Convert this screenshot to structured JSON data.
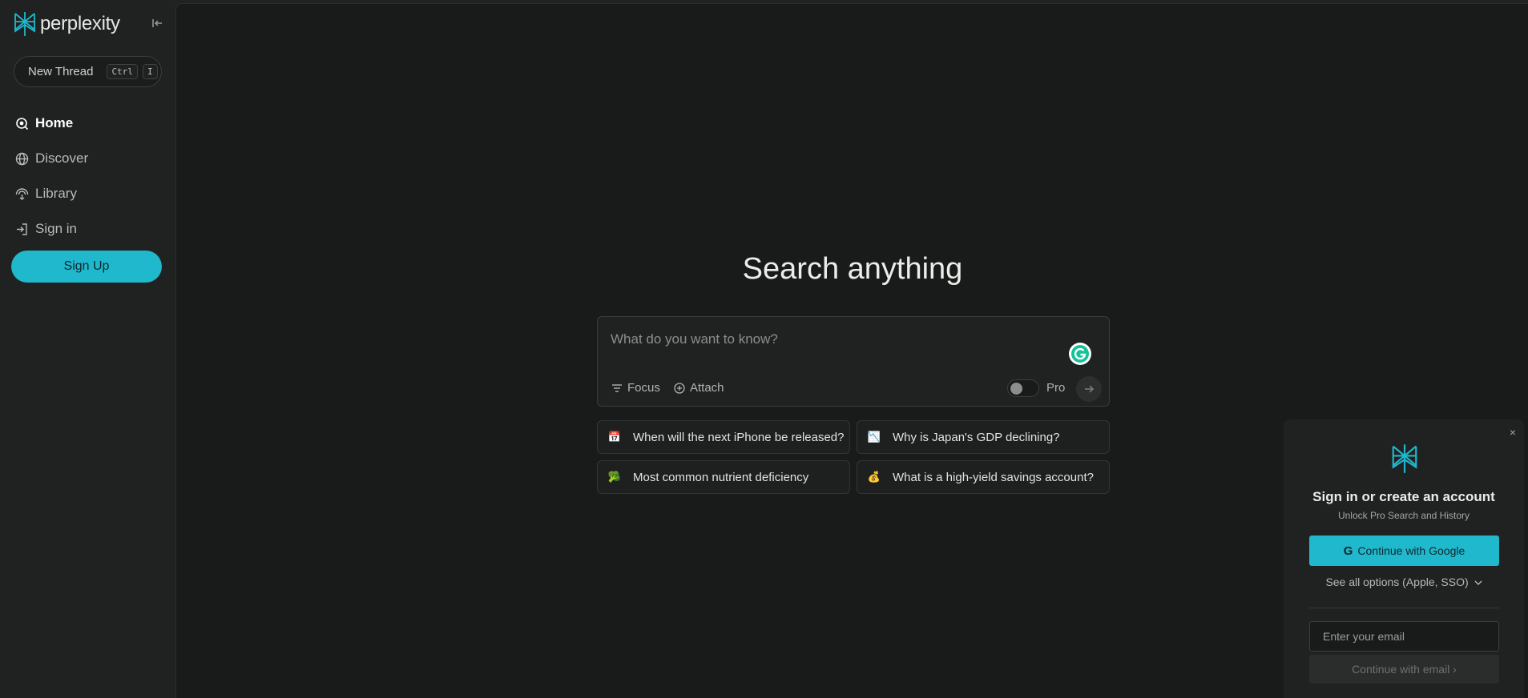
{
  "brand": {
    "name": "perplexity",
    "accent": "#1fb8cd"
  },
  "sidebar": {
    "new_thread": {
      "label": "New Thread",
      "keys": [
        "Ctrl",
        "I"
      ]
    },
    "items": [
      {
        "label": "Home",
        "icon": "home-icon",
        "active": true
      },
      {
        "label": "Discover",
        "icon": "globe-icon",
        "active": false
      },
      {
        "label": "Library",
        "icon": "library-icon",
        "active": false
      },
      {
        "label": "Sign in",
        "icon": "sign-in-icon",
        "active": false
      }
    ],
    "signup_label": "Sign Up"
  },
  "main": {
    "title": "Search anything",
    "search": {
      "placeholder": "What do you want to know?",
      "value": "",
      "focus_label": "Focus",
      "attach_label": "Attach",
      "pro_label": "Pro",
      "pro_enabled": false
    },
    "suggestions": [
      {
        "emoji": "📅",
        "text": "When will the next iPhone be released?"
      },
      {
        "emoji": "📉",
        "text": "Why is Japan's GDP declining?"
      },
      {
        "emoji": "🥦",
        "text": "Most common nutrient deficiency"
      },
      {
        "emoji": "💰",
        "text": "What is a high-yield savings account?"
      }
    ]
  },
  "auth": {
    "close": "×",
    "title": "Sign in or create an account",
    "subtitle": "Unlock Pro Search and History",
    "google_label": "Continue with Google",
    "google_glyph": "G",
    "options_label": "See all options (Apple, SSO)",
    "email_placeholder": "Enter your email",
    "email_button": "Continue with email ›"
  }
}
